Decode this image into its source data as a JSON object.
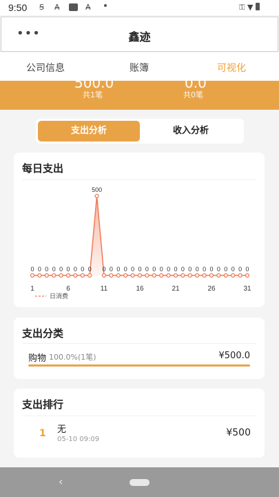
{
  "status_bar": {
    "time": "9:50",
    "icons": [
      "sim-icon",
      "a-icon",
      "square-icon",
      "a-icon",
      "dot-icon"
    ],
    "right_icons": [
      "vpn-key-icon",
      "wifi-icon",
      "battery-icon"
    ]
  },
  "header": {
    "menu_icon": "more-dots-icon",
    "title": "鑫迹"
  },
  "tabs": [
    {
      "label": "公司信息",
      "active": false
    },
    {
      "label": "账簿",
      "active": false
    },
    {
      "label": "可视化",
      "active": true
    }
  ],
  "summary": {
    "expense_total": "500.0",
    "expense_count": "共1笔",
    "income_total": "0.0",
    "income_count": "共0笔"
  },
  "toggle": {
    "expense_label": "支出分析",
    "income_label": "收入分析",
    "selected": "expense"
  },
  "daily": {
    "title": "每日支出",
    "legend": "日消费",
    "chart_data": {
      "type": "line",
      "x": [
        1,
        2,
        3,
        4,
        5,
        6,
        7,
        8,
        9,
        10,
        11,
        12,
        13,
        14,
        15,
        16,
        17,
        18,
        19,
        20,
        21,
        22,
        23,
        24,
        25,
        26,
        27,
        28,
        29,
        30,
        31
      ],
      "xticks": [
        "1",
        "6",
        "11",
        "16",
        "21",
        "26",
        "31"
      ],
      "series": [
        {
          "name": "日消费",
          "values": [
            0,
            0,
            0,
            0,
            0,
            0,
            0,
            0,
            0,
            500,
            0,
            0,
            0,
            0,
            0,
            0,
            0,
            0,
            0,
            0,
            0,
            0,
            0,
            0,
            0,
            0,
            0,
            0,
            0,
            0,
            0
          ]
        }
      ],
      "ylim": [
        0,
        500
      ],
      "data_labels": true,
      "legend_position": "bottom-left",
      "line_color": "#f07a55"
    }
  },
  "category": {
    "title": "支出分类",
    "items": [
      {
        "name": "购物",
        "percent": "100.0%(1笔)",
        "amount": "¥500.0",
        "fraction": 1.0
      }
    ],
    "accent": "#e9a347"
  },
  "ranking": {
    "title": "支出排行",
    "items": [
      {
        "rank": "1",
        "name": "无",
        "time": "05-10 09:09",
        "amount": "¥500"
      }
    ]
  },
  "nav": {
    "back_icon": "back-chevron-icon",
    "home_icon": "home-pill-icon"
  }
}
